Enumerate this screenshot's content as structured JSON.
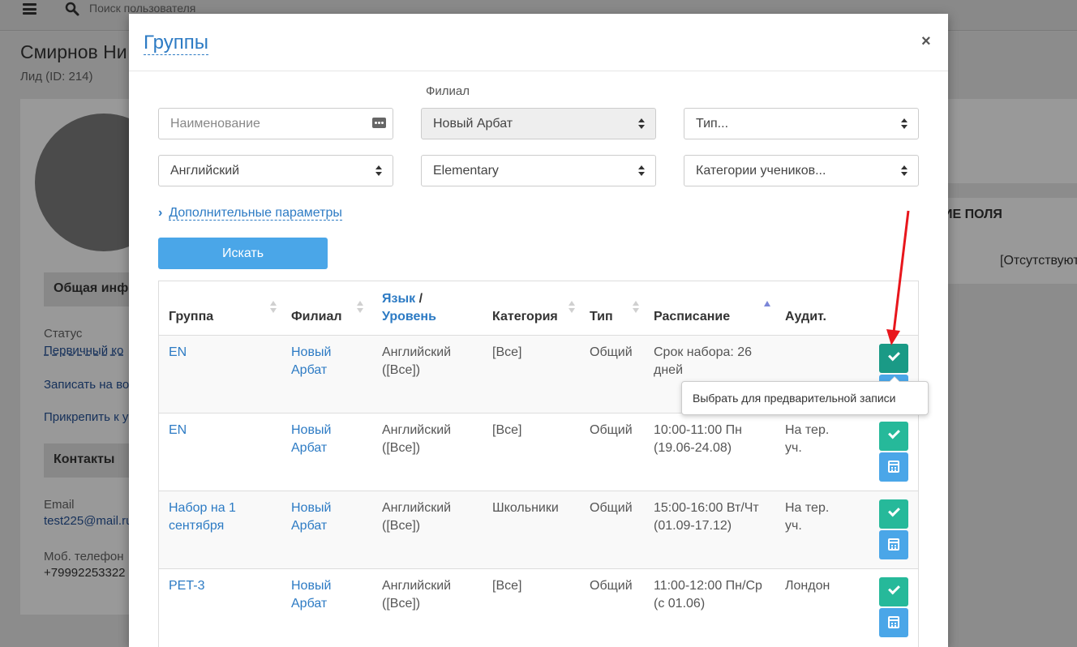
{
  "background": {
    "search_placeholder": "Поиск пользователя",
    "client_name": "Смирнов Ни",
    "lead_id": "Лид (ID: 214)",
    "section_general": "Общая инф",
    "status_label": "Статус",
    "status_value": "Первичный ко",
    "enroll_link": "Записать на во",
    "attach_link": "Прикрепить к у",
    "section_contacts": "Контакты",
    "email_label": "Email",
    "email_value": "test225@mail.ru",
    "phone_label": "Моб. телефон",
    "phone_value": "+79992253322",
    "fields_header": "ИЕ ПОЛЯ",
    "absent_value": "[Отсутствуют"
  },
  "modal": {
    "title": "Группы",
    "close": "×",
    "filters": {
      "branch_label": "Филиал",
      "name_placeholder": "Наименование",
      "branch_value": "Новый Арбат",
      "type_value": "Тип...",
      "language_value": "Английский",
      "level_value": "Elementary",
      "categories_value": "Категории учеников..."
    },
    "advanced_label": "Дополнительные параметры",
    "search_button": "Искать",
    "table": {
      "headers": {
        "group": "Группа",
        "branch": "Филиал",
        "language": "Язык",
        "slash": " /",
        "level": "Уровень",
        "category": "Категория",
        "type": "Тип",
        "schedule": "Расписание",
        "room": "Аудит."
      },
      "rows": [
        {
          "group_1": "EN",
          "group_2": "",
          "branch_1": "Новый",
          "branch_2": "Арбат",
          "lang_1": "Английский",
          "lang_2": "([Все])",
          "category": "[Все]",
          "type": "Общий",
          "sched_1": "Срок набора: 26",
          "sched_2": "дней",
          "room_1": "",
          "room_2": ""
        },
        {
          "group_1": "EN",
          "group_2": "",
          "branch_1": "Новый",
          "branch_2": "Арбат",
          "lang_1": "Английский",
          "lang_2": "([Все])",
          "category": "[Все]",
          "type": "Общий",
          "sched_1": "10:00-11:00 Пн",
          "sched_2": "(19.06-24.08)",
          "room_1": "На тер.",
          "room_2": "уч."
        },
        {
          "group_1": "Набор на 1",
          "group_2": "сентября",
          "branch_1": "Новый",
          "branch_2": "Арбат",
          "lang_1": "Английский",
          "lang_2": "([Все])",
          "category": "Школьники",
          "type": "Общий",
          "sched_1": "15:00-16:00 Вт/Чт",
          "sched_2": "(01.09-17.12)",
          "room_1": "На тер.",
          "room_2": "уч."
        },
        {
          "group_1": "PET-3",
          "group_2": "",
          "branch_1": "Новый",
          "branch_2": "Арбат",
          "lang_1": "Английский",
          "lang_2": "([Все])",
          "category": "[Все]",
          "type": "Общий",
          "sched_1": "11:00-12:00 Пн/Ср",
          "sched_2": "(с 01.06)",
          "room_1": "Лондон",
          "room_2": ""
        }
      ]
    },
    "tooltip": "Выбрать для предварительной записи"
  },
  "colors": {
    "accent": "#2d7bc4",
    "button_blue": "#4aa6e8",
    "button_green": "#26b99a",
    "annotation_arrow": "#e8161c"
  },
  "icons": [
    "hamburger-icon",
    "search-icon",
    "close-icon",
    "dots-icon",
    "sort-icon",
    "chevron-right-icon",
    "check-icon",
    "calendar-icon"
  ]
}
